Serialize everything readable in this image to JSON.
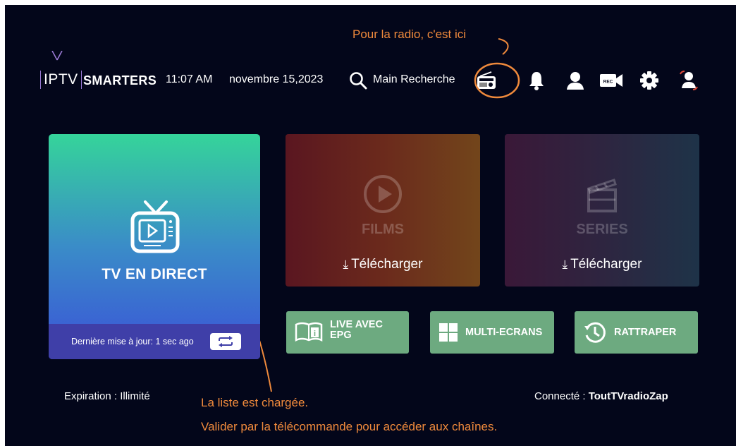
{
  "header": {
    "logo_prefix": "IPTV",
    "logo_brand": "SMARTERS",
    "time": "11:07 AM",
    "date": "novembre 15,2023",
    "search_label": "Main Recherche"
  },
  "annotations": {
    "radio_note": "Pour la radio, c'est ici",
    "list_note_1": "La liste est chargée.",
    "list_note_2": "Valider par la télécommande pour accéder aux chaînes.",
    "color": "#f08a3c"
  },
  "live_tv": {
    "title": "TV EN DIRECT",
    "last_update": "Dernière mise à jour: 1 sec ago"
  },
  "films": {
    "label": "FILMS",
    "download": "Télécharger"
  },
  "series": {
    "label": "SERIES",
    "download": "Télécharger"
  },
  "buttons": {
    "live_epg_1": "LIVE AVEC",
    "live_epg_2": "EPG",
    "multi": "MULTI-ECRANS",
    "catchup": "RATTRAPER"
  },
  "footer": {
    "expiration": "Expiration : Illimité",
    "connected_label": "Connecté : ",
    "connected_user": "ToutTVradioZap"
  },
  "icons": [
    "search-icon",
    "radio-icon",
    "bell-icon",
    "user-icon",
    "record-icon",
    "gear-icon",
    "switch-user-icon",
    "tv-icon",
    "refresh-icon",
    "play-icon",
    "clapperboard-icon",
    "download-icon",
    "book-icon",
    "grid-icon",
    "history-icon"
  ]
}
